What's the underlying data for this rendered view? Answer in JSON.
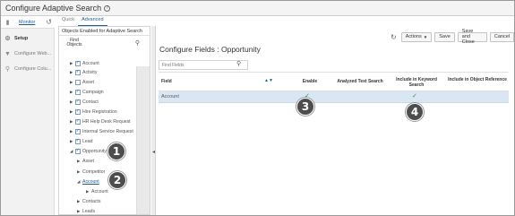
{
  "window": {
    "title": "Configure Adaptive Search"
  },
  "left_nav": {
    "items": [
      {
        "label": "Monitor"
      },
      {
        "label": "Setup"
      },
      {
        "label": "Configure Web..."
      },
      {
        "label": "Configure Colu..."
      }
    ]
  },
  "tabs": [
    {
      "label": "Quick"
    },
    {
      "label": "Advanced"
    }
  ],
  "objects_panel": {
    "header": "Objects Enabled for Adaptive Search",
    "find_label": "Find Objects",
    "tree": [
      {
        "label": "Account",
        "expanded": false,
        "checked": true
      },
      {
        "label": "Activity",
        "expanded": false,
        "checked": true
      },
      {
        "label": "Asset",
        "expanded": false,
        "checked": false
      },
      {
        "label": "Campaign",
        "expanded": false,
        "checked": true
      },
      {
        "label": "Contact",
        "expanded": false,
        "checked": true
      },
      {
        "label": "Hire Registration",
        "expanded": false,
        "checked": true
      },
      {
        "label": "HR Help Desk Request",
        "expanded": false,
        "checked": true
      },
      {
        "label": "Internal Service Request",
        "expanded": false,
        "checked": true
      },
      {
        "label": "Lead",
        "expanded": false,
        "checked": true
      },
      {
        "label": "Opportunity",
        "expanded": true,
        "checked": true
      },
      {
        "label": "Asset",
        "expanded": false,
        "checked": false
      },
      {
        "label": "Competitor",
        "expanded": false,
        "checked": false
      },
      {
        "label": "Account",
        "expanded": true,
        "checked": false
      },
      {
        "label": "Account",
        "expanded": false,
        "checked": false
      },
      {
        "label": "Contacts",
        "expanded": false,
        "checked": false
      },
      {
        "label": "Leads",
        "expanded": false,
        "checked": false
      }
    ]
  },
  "toolbar": {
    "actions_label": "Actions",
    "save_label": "Save",
    "save_close_label": "Save and Close",
    "cancel_label": "Cancel"
  },
  "configure": {
    "title": "Configure Fields : Opportunity",
    "find_fields_placeholder": "Find Fields",
    "columns": [
      "Field",
      "Enable",
      "Analyzed Text Search",
      "Include in Keyword Search",
      "Include in Object Reference"
    ],
    "rows": [
      {
        "field": "Account",
        "enable": true,
        "analyzed": false,
        "keyword": true,
        "object_ref": false
      }
    ]
  },
  "callouts": [
    "1",
    "2",
    "3",
    "4"
  ],
  "colors": {
    "accent": "#1a5ea8",
    "selected_row": "#d9e7f5",
    "callout": "#4d4d4d"
  }
}
